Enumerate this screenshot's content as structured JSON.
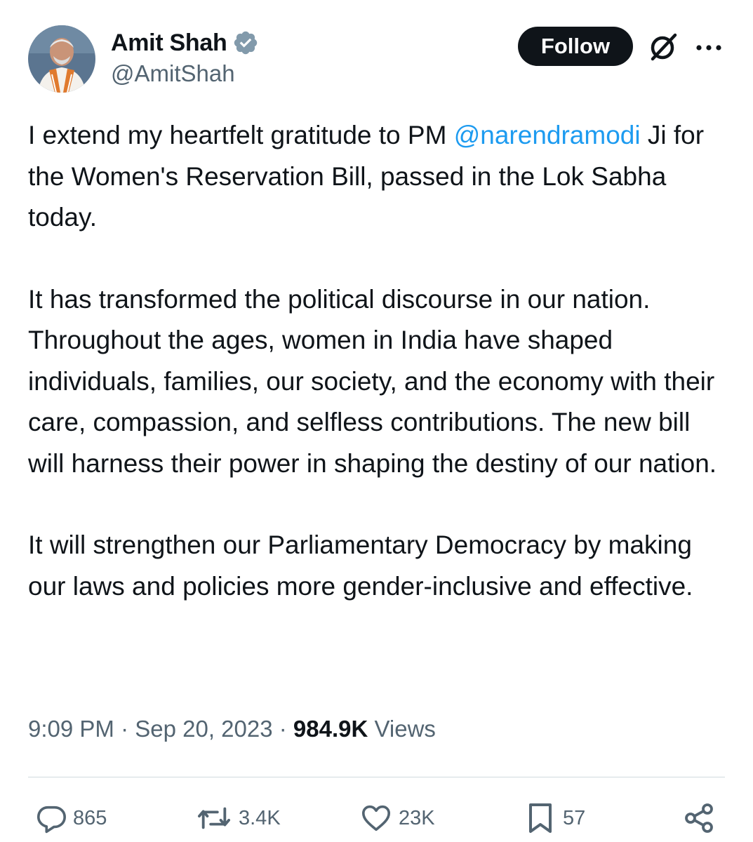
{
  "author": {
    "display_name": "Amit Shah",
    "handle": "@AmitShah",
    "verified_icon": "verified-badge-icon"
  },
  "header": {
    "follow_label": "Follow",
    "grok_icon": "grok-icon",
    "more_icon": "more-options-icon"
  },
  "tweet": {
    "p1_before": "I extend my heartfelt gratitude to PM ",
    "mention": "@narendramodi",
    "p1_after": " Ji for the Women's Reservation Bill, passed in the Lok Sabha today.",
    "p2": "It has transformed the political discourse in our nation. Throughout the ages, women in India have shaped individuals, families, our society, and the economy with their care, compassion, and selfless contributions. The new bill will harness their power in shaping the destiny of our nation.",
    "p3": "It will strengthen our Parliamentary Democracy by making our laws and policies more gender-inclusive and effective."
  },
  "meta": {
    "time": "9:09 PM",
    "separator": " · ",
    "date": "Sep 20, 2023",
    "views_count": "984.9K",
    "views_label": " Views"
  },
  "actions": {
    "replies": "865",
    "reposts": "3.4K",
    "likes": "23K",
    "bookmarks": "57",
    "icons": [
      "reply-icon",
      "repost-icon",
      "like-icon",
      "bookmark-icon",
      "share-icon"
    ]
  },
  "colors": {
    "text": "#0f1419",
    "secondary": "#536471",
    "link": "#1d9bf0",
    "verified": "#829aab",
    "follow_bg": "#0f1419",
    "divider": "#cfd9de"
  }
}
